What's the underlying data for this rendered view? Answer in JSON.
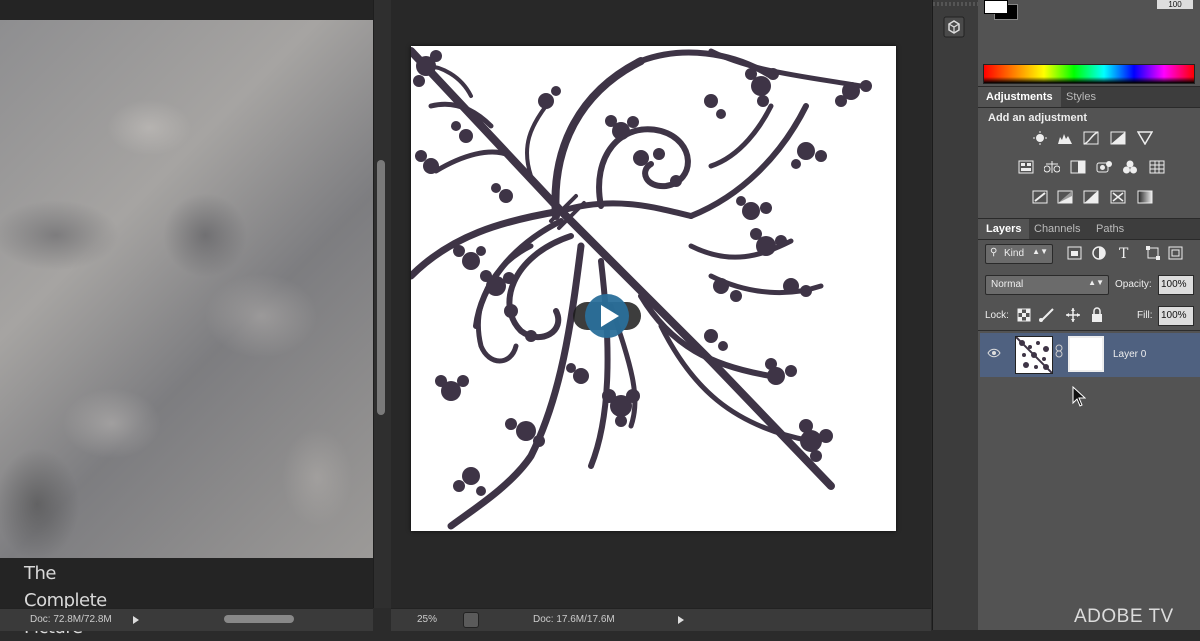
{
  "left_document": {
    "caption_lines": [
      "The",
      "Complete",
      "Picture"
    ],
    "status_doc": "Doc: 72.8M/72.8M"
  },
  "center_document": {
    "zoom": "25%",
    "status_doc": "Doc: 17.6M/17.6M"
  },
  "color_panel": {
    "k_value": "100"
  },
  "adjustments_panel": {
    "tabs": [
      "Adjustments",
      "Styles"
    ],
    "heading": "Add an adjustment",
    "icons_row1": [
      "brightness-contrast-icon",
      "levels-icon",
      "curves-icon",
      "exposure-icon",
      "vibrance-icon"
    ],
    "icons_row2": [
      "hue-saturation-icon",
      "color-balance-icon",
      "black-white-icon",
      "photo-filter-icon",
      "channel-mixer-icon",
      "color-lookup-icon"
    ],
    "icons_row3": [
      "invert-icon",
      "posterize-icon",
      "threshold-icon",
      "selective-color-icon",
      "gradient-map-icon"
    ]
  },
  "layers_panel": {
    "tabs": [
      "Layers",
      "Channels",
      "Paths"
    ],
    "filter_kind": "Kind",
    "blend_mode": "Normal",
    "opacity_label": "Opacity:",
    "opacity_value": "100%",
    "lock_label": "Lock:",
    "fill_label": "Fill:",
    "fill_value": "100%",
    "layers": [
      {
        "name": "Layer 0"
      }
    ]
  },
  "watermark": "ADOBE TV",
  "colors": {
    "ornament": "#3e3446",
    "panel": "#535353",
    "selected_layer": "#4f6180",
    "play_button": "#2a6f9a"
  }
}
